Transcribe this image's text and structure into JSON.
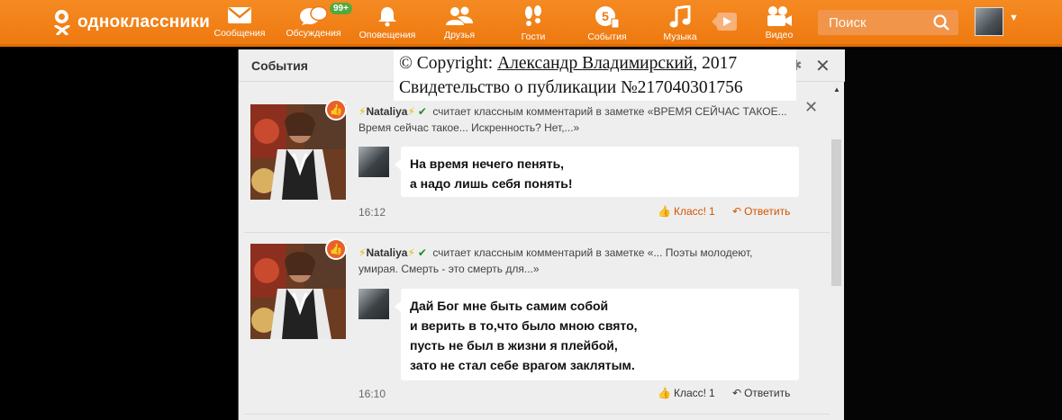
{
  "header": {
    "logo_text": "одноклассники",
    "badge": "99+",
    "nav": [
      {
        "label": "Сообщения",
        "icon": "envelope-icon"
      },
      {
        "label": "Обсуждения",
        "icon": "chat-bubbles-icon"
      },
      {
        "label": "Оповещения",
        "icon": "bell-icon"
      },
      {
        "label": "Друзья",
        "icon": "friends-icon"
      },
      {
        "label": "Гости",
        "icon": "footprints-icon"
      },
      {
        "label": "События",
        "icon": "events-icon"
      },
      {
        "label": "Музыка",
        "icon": "music-note-icon"
      },
      {
        "label": "Видео",
        "icon": "video-camera-icon"
      }
    ],
    "search_placeholder": "Поиск",
    "accent": "#ee7a10"
  },
  "copyright": {
    "line1_prefix": "© Copyright: ",
    "author": "Александр Владимирский",
    "line1_suffix": ", 2017",
    "line2": "Свидетельство о публикации №217040301756"
  },
  "panel": {
    "title": "События",
    "events": [
      {
        "user": "Nataliya",
        "action": "считает классным комментарий в заметке «ВРЕМЯ СЕЙЧАС ТАКОЕ... Время сейчас такое... Искренность? Нет,...»",
        "comment_lines": [
          "На время нечего пенять,",
          "а надо лишь себя понять!"
        ],
        "time": "16:12",
        "class_label": "Класс!",
        "class_count": "1",
        "reply_label": "Ответить"
      },
      {
        "user": "Nataliya",
        "action": "считает классным комментарий в заметке «... Поэты молодеют, умирая. Смерть - это смерть для...»",
        "comment_lines": [
          "Дай Бог мне быть самим собой",
          "и верить в то,что было мною свято,",
          "пусть не был в жизни я плейбой,",
          "зато не стал себе врагом заклятым."
        ],
        "time": "16:10",
        "class_label": "Класс!",
        "class_count": "1",
        "reply_label": "Ответить"
      }
    ]
  }
}
